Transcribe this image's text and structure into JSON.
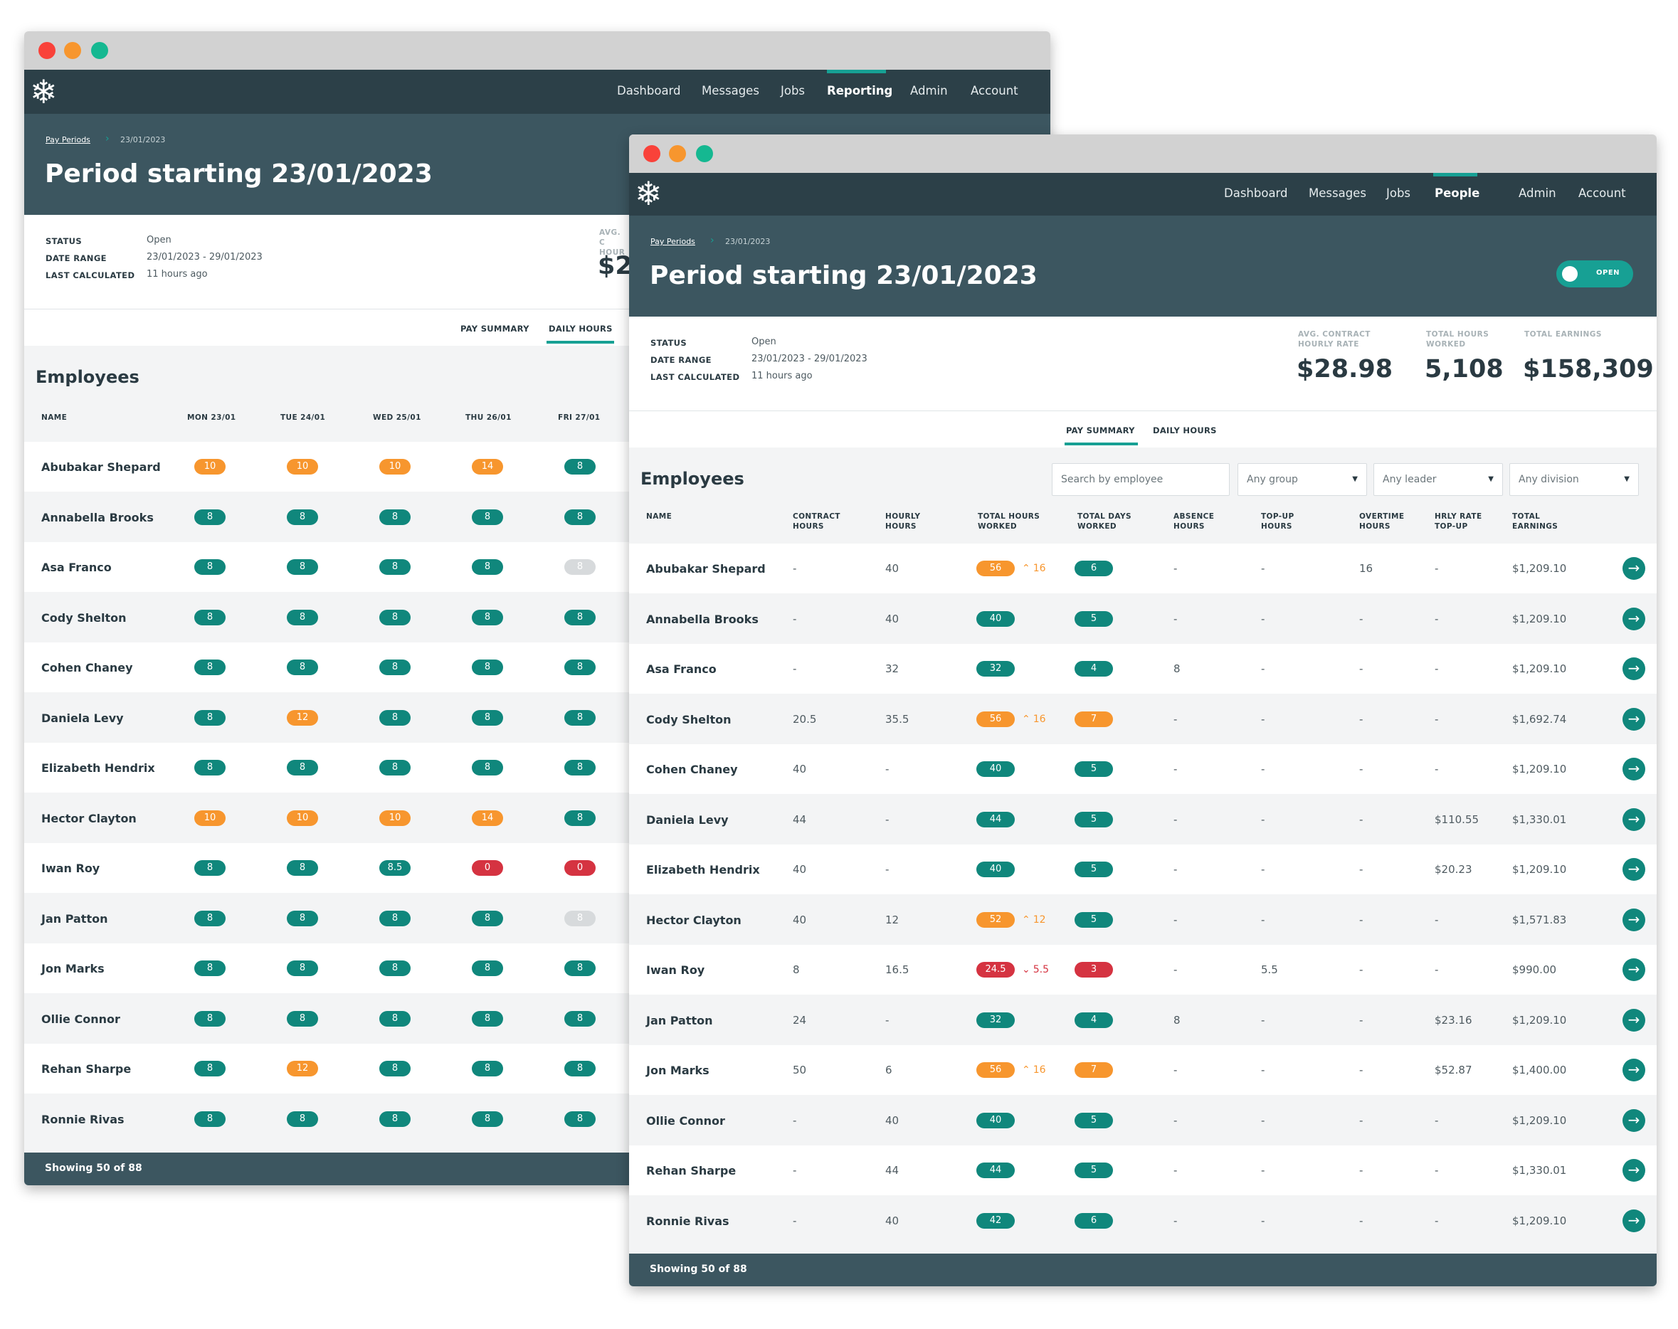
{
  "nav": [
    "Dashboard",
    "Messages",
    "Jobs",
    "Reporting",
    "Admin",
    "Account"
  ],
  "nav_front": [
    "Dashboard",
    "Messages",
    "Jobs",
    "People",
    "Admin",
    "Account"
  ],
  "breadcrumb": {
    "parent": "Pay Periods",
    "current": "23/01/2023"
  },
  "title": "Period starting 23/01/2023",
  "status_label": "STATUS",
  "status_value": "Open",
  "date_range_label": "DATE RANGE",
  "date_range_value": "23/01/2023 - 29/01/2023",
  "last_calc_label": "LAST CALCULATED",
  "last_calc_value": "11 hours ago",
  "toggle_label": "OPEN",
  "stats": [
    {
      "label": "AVG. CONTRACT HOURLY RATE",
      "value": "$28.98"
    },
    {
      "label": "TOTAL HOURS WORKED",
      "value": "5,108"
    },
    {
      "label": "TOTAL EARNINGS",
      "value": "$158,309"
    }
  ],
  "back_stat": {
    "label": "AVG. C HOUR",
    "value": "$2"
  },
  "tabs": [
    "PAY SUMMARY",
    "DAILY HOURS"
  ],
  "employees_heading": "Employees",
  "filters": {
    "search_placeholder": "Search by employee",
    "group": "Any group",
    "leader": "Any leader",
    "division": "Any division"
  },
  "daily_columns": [
    "NAME",
    "MON 23/01",
    "TUE 24/01",
    "WED 25/01",
    "THU 26/01",
    "FRI 27/01"
  ],
  "daily_rows": [
    {
      "name": "Abubakar Shepard",
      "days": [
        [
          "10",
          "orange"
        ],
        [
          "10",
          "orange"
        ],
        [
          "10",
          "orange"
        ],
        [
          "14",
          "orange"
        ],
        [
          "8",
          "teal"
        ]
      ]
    },
    {
      "name": "Annabella Brooks",
      "days": [
        [
          "8",
          "teal"
        ],
        [
          "8",
          "teal"
        ],
        [
          "8",
          "teal"
        ],
        [
          "8",
          "teal"
        ],
        [
          "8",
          "teal"
        ]
      ]
    },
    {
      "name": "Asa Franco",
      "days": [
        [
          "8",
          "teal"
        ],
        [
          "8",
          "teal"
        ],
        [
          "8",
          "teal"
        ],
        [
          "8",
          "teal"
        ],
        [
          "8",
          "gray"
        ]
      ]
    },
    {
      "name": "Cody Shelton",
      "days": [
        [
          "8",
          "teal"
        ],
        [
          "8",
          "teal"
        ],
        [
          "8",
          "teal"
        ],
        [
          "8",
          "teal"
        ],
        [
          "8",
          "teal"
        ]
      ]
    },
    {
      "name": "Cohen Chaney",
      "days": [
        [
          "8",
          "teal"
        ],
        [
          "8",
          "teal"
        ],
        [
          "8",
          "teal"
        ],
        [
          "8",
          "teal"
        ],
        [
          "8",
          "teal"
        ]
      ]
    },
    {
      "name": "Daniela Levy",
      "days": [
        [
          "8",
          "teal"
        ],
        [
          "12",
          "orange"
        ],
        [
          "8",
          "teal"
        ],
        [
          "8",
          "teal"
        ],
        [
          "8",
          "teal"
        ]
      ]
    },
    {
      "name": "Elizabeth Hendrix",
      "days": [
        [
          "8",
          "teal"
        ],
        [
          "8",
          "teal"
        ],
        [
          "8",
          "teal"
        ],
        [
          "8",
          "teal"
        ],
        [
          "8",
          "teal"
        ]
      ]
    },
    {
      "name": "Hector Clayton",
      "days": [
        [
          "10",
          "orange"
        ],
        [
          "10",
          "orange"
        ],
        [
          "10",
          "orange"
        ],
        [
          "14",
          "orange"
        ],
        [
          "8",
          "teal"
        ]
      ]
    },
    {
      "name": "Iwan Roy",
      "days": [
        [
          "8",
          "teal"
        ],
        [
          "8",
          "teal"
        ],
        [
          "8.5",
          "teal"
        ],
        [
          "0",
          "red"
        ],
        [
          "0",
          "red"
        ]
      ]
    },
    {
      "name": "Jan Patton",
      "days": [
        [
          "8",
          "teal"
        ],
        [
          "8",
          "teal"
        ],
        [
          "8",
          "teal"
        ],
        [
          "8",
          "teal"
        ],
        [
          "8",
          "gray"
        ]
      ]
    },
    {
      "name": "Jon Marks",
      "days": [
        [
          "8",
          "teal"
        ],
        [
          "8",
          "teal"
        ],
        [
          "8",
          "teal"
        ],
        [
          "8",
          "teal"
        ],
        [
          "8",
          "teal"
        ]
      ]
    },
    {
      "name": "Ollie Connor",
      "days": [
        [
          "8",
          "teal"
        ],
        [
          "8",
          "teal"
        ],
        [
          "8",
          "teal"
        ],
        [
          "8",
          "teal"
        ],
        [
          "8",
          "teal"
        ]
      ]
    },
    {
      "name": "Rehan Sharpe",
      "days": [
        [
          "8",
          "teal"
        ],
        [
          "12",
          "orange"
        ],
        [
          "8",
          "teal"
        ],
        [
          "8",
          "teal"
        ],
        [
          "8",
          "teal"
        ]
      ]
    },
    {
      "name": "Ronnie Rivas",
      "days": [
        [
          "8",
          "teal"
        ],
        [
          "8",
          "teal"
        ],
        [
          "8",
          "teal"
        ],
        [
          "8",
          "teal"
        ],
        [
          "8",
          "teal"
        ]
      ]
    }
  ],
  "pay_columns": [
    "NAME",
    "CONTRACT HOURS",
    "HOURLY HOURS",
    "TOTAL HOURS WORKED",
    "TOTAL DAYS WORKED",
    "ABSENCE HOURS",
    "TOP-UP HOURS",
    "OVERTIME HOURS",
    "HRLY RATE TOP-UP",
    "TOTAL EARNINGS"
  ],
  "pay_rows": [
    {
      "name": "Abubakar Shepard",
      "contract": "-",
      "hourly": "40",
      "total": "56",
      "total_color": "orange",
      "delta": "16",
      "delta_dir": "up",
      "days": "6",
      "days_color": "teal",
      "absence": "-",
      "topup": "-",
      "overtime": "16",
      "rate_topup": "-",
      "earnings": "$1,209.10"
    },
    {
      "name": "Annabella Brooks",
      "contract": "-",
      "hourly": "40",
      "total": "40",
      "total_color": "teal",
      "delta": "",
      "delta_dir": "",
      "days": "5",
      "days_color": "teal",
      "absence": "-",
      "topup": "-",
      "overtime": "-",
      "rate_topup": "-",
      "earnings": "$1,209.10"
    },
    {
      "name": "Asa Franco",
      "contract": "-",
      "hourly": "32",
      "total": "32",
      "total_color": "teal",
      "delta": "",
      "delta_dir": "",
      "days": "4",
      "days_color": "teal",
      "absence": "8",
      "topup": "-",
      "overtime": "-",
      "rate_topup": "-",
      "earnings": "$1,209.10"
    },
    {
      "name": "Cody Shelton",
      "contract": "20.5",
      "hourly": "35.5",
      "total": "56",
      "total_color": "orange",
      "delta": "16",
      "delta_dir": "up",
      "days": "7",
      "days_color": "orange",
      "absence": "-",
      "topup": "-",
      "overtime": "-",
      "rate_topup": "-",
      "earnings": "$1,692.74"
    },
    {
      "name": "Cohen Chaney",
      "contract": "40",
      "hourly": "-",
      "total": "40",
      "total_color": "teal",
      "delta": "",
      "delta_dir": "",
      "days": "5",
      "days_color": "teal",
      "absence": "-",
      "topup": "-",
      "overtime": "-",
      "rate_topup": "-",
      "earnings": "$1,209.10"
    },
    {
      "name": "Daniela Levy",
      "contract": "44",
      "hourly": "-",
      "total": "44",
      "total_color": "teal",
      "delta": "",
      "delta_dir": "",
      "days": "5",
      "days_color": "teal",
      "absence": "-",
      "topup": "-",
      "overtime": "-",
      "rate_topup": "$110.55",
      "earnings": "$1,330.01"
    },
    {
      "name": "Elizabeth Hendrix",
      "contract": "40",
      "hourly": "-",
      "total": "40",
      "total_color": "teal",
      "delta": "",
      "delta_dir": "",
      "days": "5",
      "days_color": "teal",
      "absence": "-",
      "topup": "-",
      "overtime": "-",
      "rate_topup": "$20.23",
      "earnings": "$1,209.10"
    },
    {
      "name": "Hector Clayton",
      "contract": "40",
      "hourly": "12",
      "total": "52",
      "total_color": "orange",
      "delta": "12",
      "delta_dir": "up",
      "days": "5",
      "days_color": "teal",
      "absence": "-",
      "topup": "-",
      "overtime": "-",
      "rate_topup": "-",
      "earnings": "$1,571.83"
    },
    {
      "name": "Iwan Roy",
      "contract": "8",
      "hourly": "16.5",
      "total": "24.5",
      "total_color": "red",
      "delta": "5.5",
      "delta_dir": "down",
      "days": "3",
      "days_color": "red",
      "absence": "-",
      "topup": "5.5",
      "overtime": "-",
      "rate_topup": "-",
      "earnings": "$990.00"
    },
    {
      "name": "Jan Patton",
      "contract": "24",
      "hourly": "-",
      "total": "32",
      "total_color": "teal",
      "delta": "",
      "delta_dir": "",
      "days": "4",
      "days_color": "teal",
      "absence": "8",
      "topup": "-",
      "overtime": "-",
      "rate_topup": "$23.16",
      "earnings": "$1,209.10"
    },
    {
      "name": "Jon Marks",
      "contract": "50",
      "hourly": "6",
      "total": "56",
      "total_color": "orange",
      "delta": "16",
      "delta_dir": "up",
      "days": "7",
      "days_color": "orange",
      "absence": "-",
      "topup": "-",
      "overtime": "-",
      "rate_topup": "$52.87",
      "earnings": "$1,400.00"
    },
    {
      "name": "Ollie Connor",
      "contract": "-",
      "hourly": "40",
      "total": "40",
      "total_color": "teal",
      "delta": "",
      "delta_dir": "",
      "days": "5",
      "days_color": "teal",
      "absence": "-",
      "topup": "-",
      "overtime": "-",
      "rate_topup": "-",
      "earnings": "$1,209.10"
    },
    {
      "name": "Rehan Sharpe",
      "contract": "-",
      "hourly": "44",
      "total": "44",
      "total_color": "teal",
      "delta": "",
      "delta_dir": "",
      "days": "5",
      "days_color": "teal",
      "absence": "-",
      "topup": "-",
      "overtime": "-",
      "rate_topup": "-",
      "earnings": "$1,330.01"
    },
    {
      "name": "Ronnie Rivas",
      "contract": "-",
      "hourly": "40",
      "total": "42",
      "total_color": "teal",
      "delta": "",
      "delta_dir": "",
      "days": "6",
      "days_color": "teal",
      "absence": "-",
      "topup": "-",
      "overtime": "-",
      "rate_topup": "-",
      "earnings": "$1,209.10"
    }
  ],
  "footer": "Showing 50 of 88",
  "icons": {
    "logo": "snowflake-icon",
    "breadcrumb_sep": "chevron-right-icon",
    "row_action": "arrow-right-circle-icon",
    "up": "chevron-up-icon",
    "down": "chevron-down-icon"
  },
  "colors": {
    "nav_bg": "#2c4048",
    "header_bg": "#3c5660",
    "accent": "#17a094",
    "teal_pill": "#10877c",
    "orange_pill": "#f7962e",
    "red_pill": "#d53341",
    "disabled_pill": "#d7dadc"
  }
}
